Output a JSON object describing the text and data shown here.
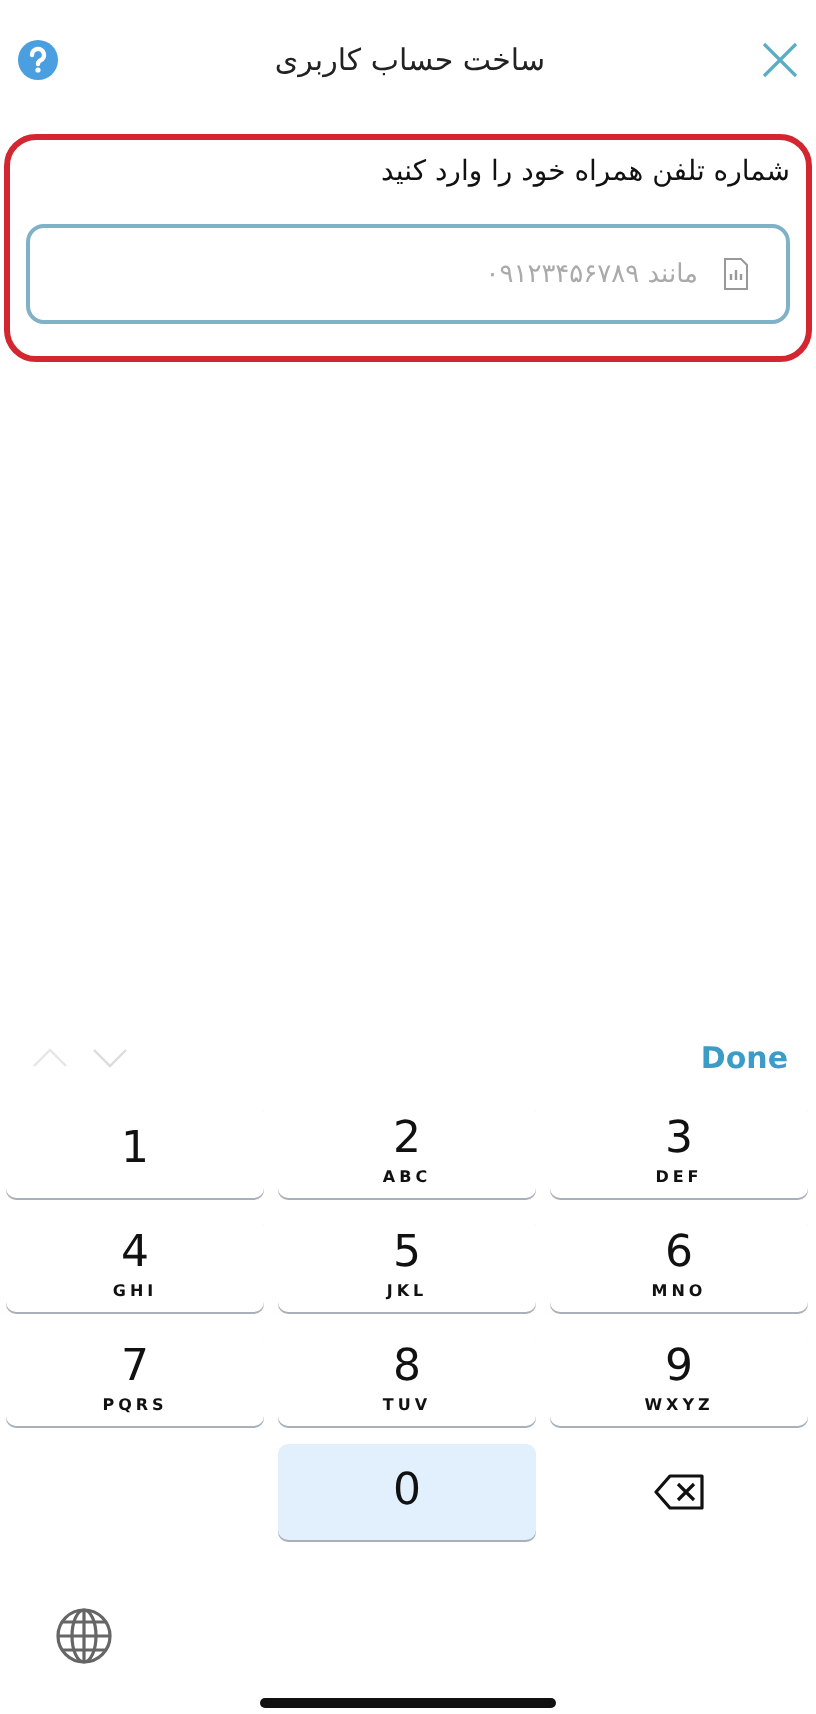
{
  "header": {
    "title": "ساخت حساب کاربری"
  },
  "form": {
    "label": "شماره تلفن همراه خود را وارد کنید",
    "phone_field": {
      "placeholder": "مانند ۰۹۱۲۳۴۵۶۷۸۹"
    }
  },
  "keyboard_toolbar": {
    "previous_enabled": false,
    "next_enabled": false,
    "done": "Done"
  },
  "keys": [
    {
      "kind": "digit",
      "digit": "1",
      "pressed": false
    },
    {
      "kind": "digit",
      "digit": "2",
      "letters": "ABC",
      "pressed": false
    },
    {
      "kind": "digit",
      "digit": "3",
      "letters": "DEF",
      "pressed": false
    },
    {
      "kind": "digit",
      "digit": "4",
      "letters": "GHI",
      "pressed": false
    },
    {
      "kind": "digit",
      "digit": "5",
      "letters": "JKL",
      "pressed": false
    },
    {
      "kind": "digit",
      "digit": "6",
      "letters": "MNO",
      "pressed": false
    },
    {
      "kind": "digit",
      "digit": "7",
      "letters": "PQRS",
      "pressed": false
    },
    {
      "kind": "digit",
      "digit": "8",
      "letters": "TUV",
      "pressed": false
    },
    {
      "kind": "digit",
      "digit": "9",
      "letters": "WXYZ",
      "pressed": false
    },
    {
      "kind": "blank"
    },
    {
      "kind": "digit",
      "digit": "0",
      "pressed": true
    },
    {
      "kind": "delete"
    }
  ]
}
